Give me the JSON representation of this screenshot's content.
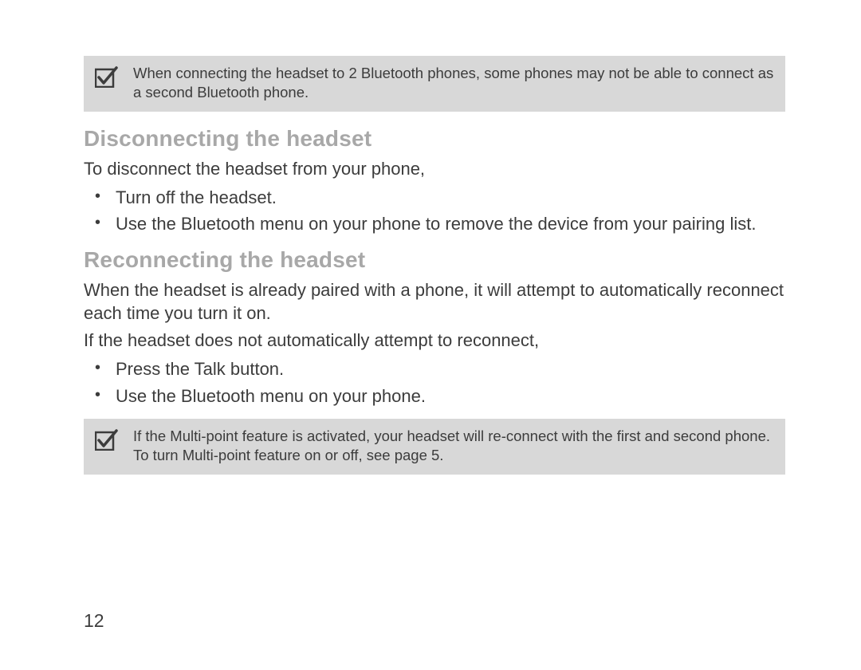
{
  "notes": {
    "top": "When connecting the headset to 2 Bluetooth phones, some phones may not be able to connect as a second Bluetooth phone.",
    "bottom": "If the Multi-point feature is activated, your headset will re-connect with the first and second phone. To turn Multi-point feature on or off, see page 5."
  },
  "sections": {
    "disconnecting": {
      "heading": "Disconnecting the headset",
      "intro": "To disconnect the headset from your phone,",
      "bullets": [
        "Turn off the headset.",
        "Use the Bluetooth menu on your phone to remove the device from your pairing list."
      ]
    },
    "reconnecting": {
      "heading": "Reconnecting the headset",
      "para1": "When the headset is already paired with a phone, it will attempt to automatically reconnect each time you turn it on.",
      "para2": "If the headset does not automatically attempt to reconnect,",
      "bullets": [
        "Press the Talk button.",
        "Use the Bluetooth menu on your phone."
      ]
    }
  },
  "page_number": "12"
}
